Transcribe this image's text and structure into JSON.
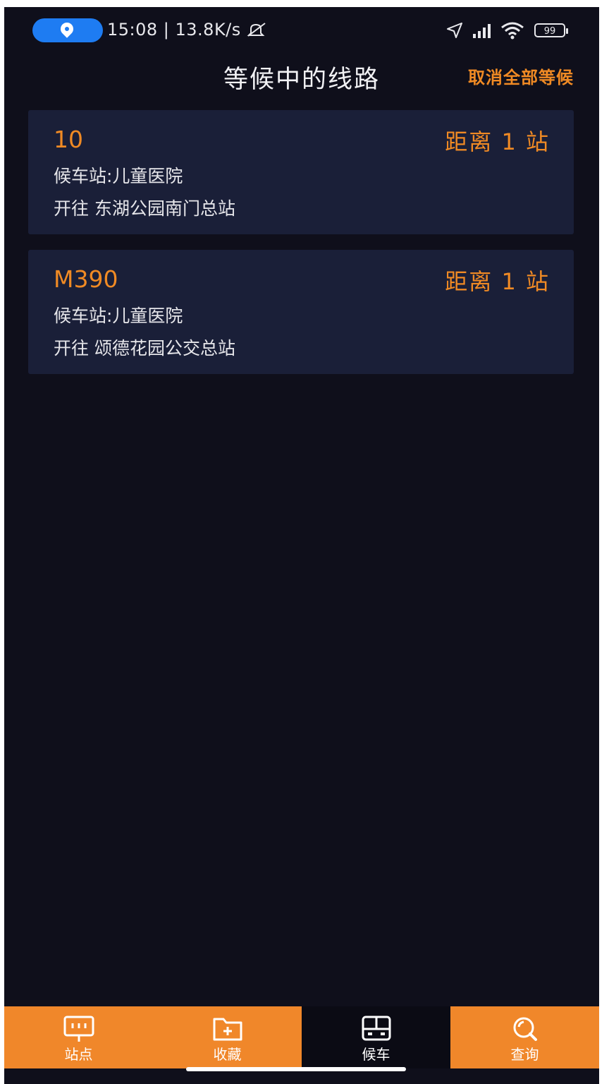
{
  "status_bar": {
    "time_network": "15:08 | 13.8K/s",
    "battery": "99"
  },
  "header": {
    "title": "等候中的线路",
    "cancel_all": "取消全部等候"
  },
  "routes": [
    {
      "route": "10",
      "distance": "距离 1 站",
      "stop": "候车站:儿童医院",
      "direction": "开往 东湖公园南门总站"
    },
    {
      "route": "M390",
      "distance": "距离 1 站",
      "stop": "候车站:儿童医院",
      "direction": "开往 颂德花园公交总站"
    }
  ],
  "tabs": [
    {
      "label": "站点",
      "icon": "bus-stop-icon"
    },
    {
      "label": "收藏",
      "icon": "favorites-folder-icon"
    },
    {
      "label": "候车",
      "icon": "bus-front-icon"
    },
    {
      "label": "查询",
      "icon": "search-icon"
    }
  ],
  "active_tab": "候车",
  "colors": {
    "accent": "#f08a24",
    "background": "#0f0f1b",
    "card": "#1a1f38",
    "location_pill": "#1e7cf2"
  }
}
